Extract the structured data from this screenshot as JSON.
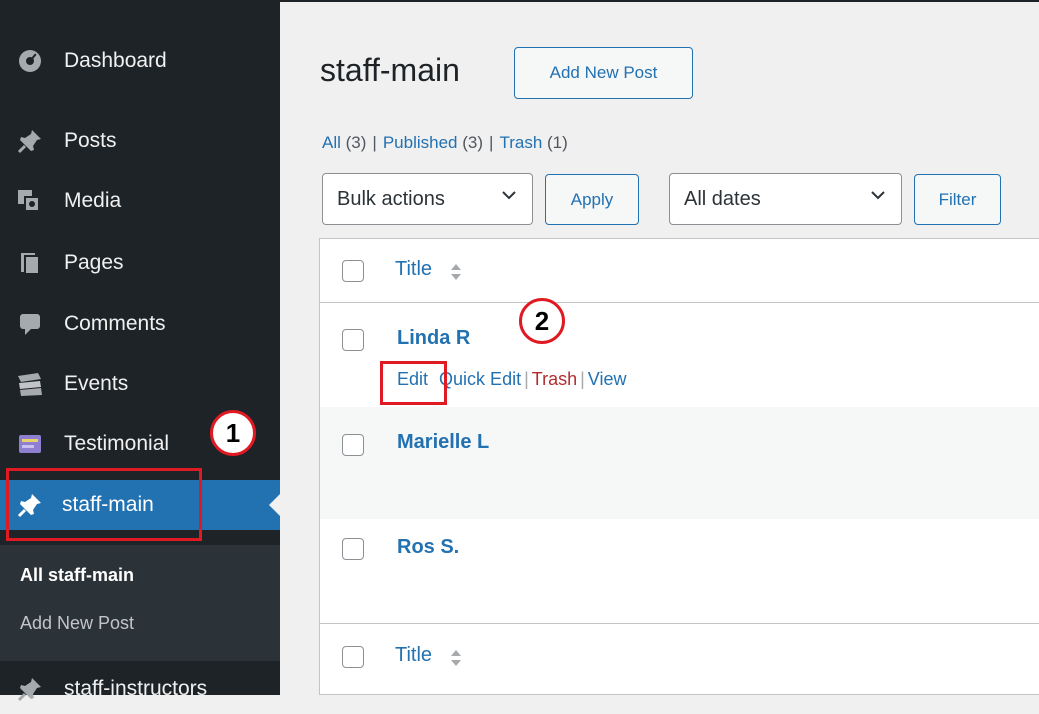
{
  "sidebar": {
    "items": [
      {
        "label": "Dashboard",
        "icon": "dashboard-icon"
      },
      {
        "label": "Posts",
        "icon": "pushpin-icon"
      },
      {
        "label": "Media",
        "icon": "media-icon"
      },
      {
        "label": "Pages",
        "icon": "pages-icon"
      },
      {
        "label": "Comments",
        "icon": "comments-icon"
      },
      {
        "label": "Events",
        "icon": "events-icon"
      },
      {
        "label": "Testimonial",
        "icon": "testimonial-icon"
      },
      {
        "label": "staff-main",
        "icon": "pushpin-icon"
      },
      {
        "label": "staff-instructors",
        "icon": "pushpin-icon"
      }
    ],
    "submenu": {
      "all_label": "All staff-main",
      "add_label": "Add New Post"
    }
  },
  "annotations": {
    "step1": "1",
    "step2": "2"
  },
  "main": {
    "title": "staff-main",
    "add_new_label": "Add New Post",
    "views": {
      "all_label": "All",
      "all_count": "(3)",
      "published_label": "Published",
      "published_count": "(3)",
      "trash_label": "Trash",
      "trash_count": "(1)"
    },
    "bulk_actions": {
      "selected": "Bulk actions",
      "apply_label": "Apply"
    },
    "dates": {
      "selected": "All dates",
      "filter_label": "Filter"
    },
    "table": {
      "column_title": "Title",
      "rows": [
        {
          "title": "Linda R"
        },
        {
          "title": "Marielle L"
        },
        {
          "title": "Ros S."
        }
      ],
      "row_actions": {
        "edit": "Edit",
        "quick_edit": "Quick Edit",
        "trash": "Trash",
        "view": "View"
      }
    }
  },
  "colors": {
    "sidebar_bg": "#1d2327",
    "accent": "#2271b1",
    "annotation_red": "#e01a22",
    "trash_red": "#b32d2e"
  }
}
